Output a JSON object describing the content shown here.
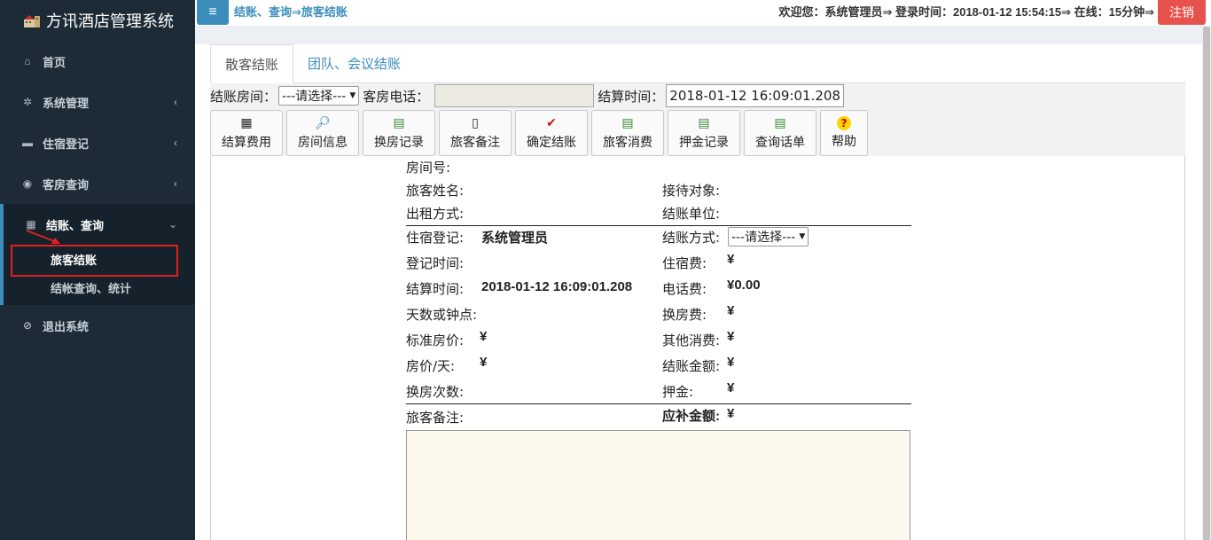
{
  "sidebar": {
    "brand": "方讯酒店管理系统",
    "items": [
      {
        "label": "首页",
        "icon": "home-icon"
      },
      {
        "label": "系统管理",
        "icon": "gear-icon"
      },
      {
        "label": "住宿登记",
        "icon": "bed-icon"
      },
      {
        "label": "客房查询",
        "icon": "eye-icon"
      },
      {
        "label": "结账、查询",
        "icon": "calculator-icon"
      },
      {
        "label": "退出系统",
        "icon": "ban-icon"
      }
    ],
    "sub_items": [
      {
        "label": "旅客结账"
      },
      {
        "label": "结帐查询、统计"
      }
    ]
  },
  "topbar": {
    "menu_icon": "≡",
    "breadcrumb": "结账、查询⇒旅客结账",
    "welcome": "欢迎您：系统管理员⇒ 登录时间：2018-01-12 15:54:15⇒ 在线：15分钟⇒",
    "logout": "注销"
  },
  "tabs": [
    {
      "label": "散客结账"
    },
    {
      "label": "团队、会议结账"
    }
  ],
  "form": {
    "room_label": "结账房间：",
    "room_select": "---请选择---",
    "tel_label": "客房电话：",
    "tel_value": "",
    "time_label": "结算时间：",
    "time_value": "2018-01-12 16:09:01.208"
  },
  "toolbar": [
    {
      "label": "结算费用",
      "icon": "calculator-icon"
    },
    {
      "label": "房间信息",
      "icon": "magnifier-icon"
    },
    {
      "label": "换房记录",
      "icon": "document-icon"
    },
    {
      "label": "旅客备注",
      "icon": "note-icon"
    },
    {
      "label": "确定结账",
      "icon": "checkmark-icon"
    },
    {
      "label": "旅客消费",
      "icon": "document-icon"
    },
    {
      "label": "押金记录",
      "icon": "document-icon"
    },
    {
      "label": "查询话单",
      "icon": "document-icon"
    },
    {
      "label": "帮助",
      "icon": "help-icon"
    }
  ],
  "detail": {
    "room_no": "房间号:",
    "guest_name": "旅客姓名:",
    "reception": "接待对象:",
    "rent_mode": "出租方式:",
    "settle_unit": "结账单位:",
    "checkin_label": "住宿登记:",
    "checkin_value": "系统管理员",
    "pay_mode_label": "结账方式:",
    "pay_mode_value": "---请选择---",
    "reg_time_label": "登记时间:",
    "lodging_fee_label": "住宿费:",
    "lodging_fee_value": "¥",
    "settle_time_label": "结算时间:",
    "settle_time_value": "2018-01-12 16:09:01.208",
    "phone_fee_label": "电话费:",
    "phone_fee_value": "¥0.00",
    "days_label": "天数或钟点:",
    "change_fee_label": "换房费:",
    "change_fee_value": "¥",
    "std_price_label": "标准房价:",
    "std_price_value": "¥",
    "other_label": "其他消费:",
    "other_value": "¥",
    "daily_label": "房价/天:",
    "daily_value": "¥",
    "amount_label": "结账金额:",
    "amount_value": "¥",
    "change_count_label": "换房次数:",
    "deposit_label": "押金:",
    "deposit_value": "¥",
    "remark_label": "旅客备注:",
    "due_label": "应补金额:",
    "due_value": "¥"
  }
}
